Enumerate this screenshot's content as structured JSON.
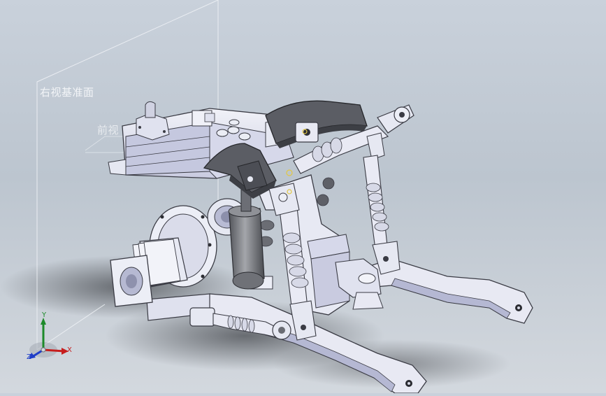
{
  "viewport": {
    "planes": {
      "right_plane_label": "右视基准面",
      "front_plane_label": "前视"
    },
    "triad": {
      "x_label": "X",
      "y_label": "Y",
      "z_label": "Z"
    },
    "colors": {
      "background_top": "#c9d1db",
      "background_bottom": "#d3d8de",
      "part_body": "#e6e8f2",
      "part_shade": "#9ea3c4",
      "linkage_dark": "#5b5d64",
      "cylinder": "#7b7d83",
      "axis_x": "#c61e1e",
      "axis_y": "#1d8a2a",
      "axis_z": "#1f3ec8"
    }
  }
}
